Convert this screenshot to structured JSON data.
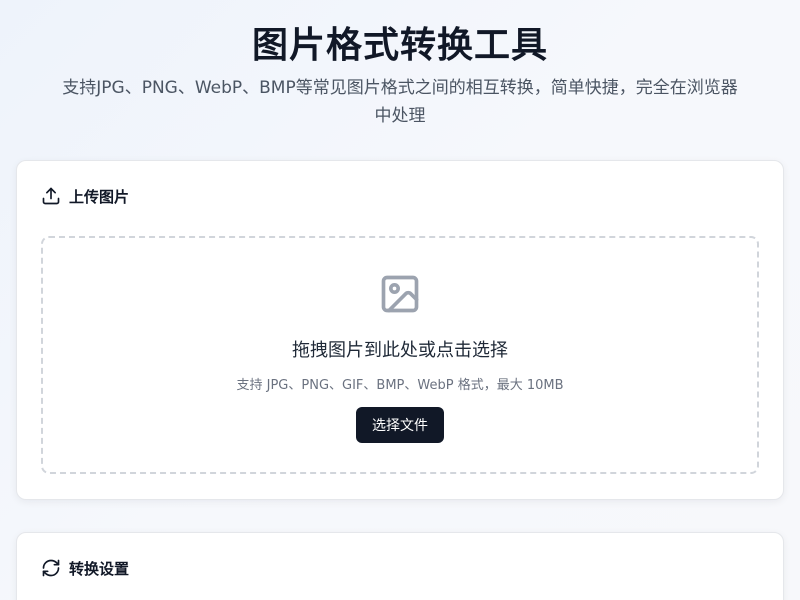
{
  "header": {
    "title": "图片格式转换工具",
    "subtitle": "支持JPG、PNG、WebP、BMP等常见图片格式之间的相互转换，简单快捷，完全在浏览器中处理"
  },
  "upload_card": {
    "title": "上传图片",
    "icon": "upload-icon",
    "dropzone": {
      "icon": "image-icon",
      "main_text": "拖拽图片到此处或点击选择",
      "sub_text": "支持 JPG、PNG、GIF、BMP、WebP 格式，最大 10MB",
      "button_label": "选择文件"
    }
  },
  "settings_card": {
    "title": "转换设置",
    "icon": "refresh-icon"
  },
  "colors": {
    "primary_button": "#111827",
    "dashed_border": "#d1d5db",
    "muted_text": "#6b7280"
  }
}
